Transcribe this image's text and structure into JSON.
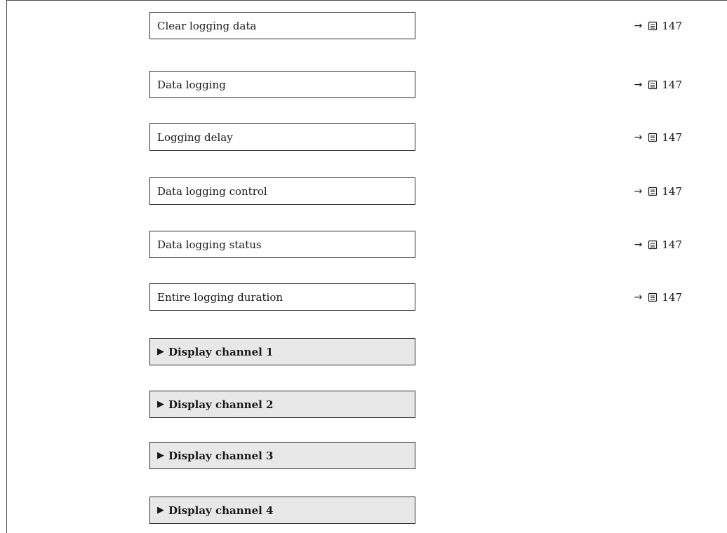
{
  "parameters": [
    {
      "label": "Clear logging data",
      "ref_page": "147"
    },
    {
      "label": "Data logging",
      "ref_page": "147"
    },
    {
      "label": "Logging delay",
      "ref_page": "147"
    },
    {
      "label": "Data logging control",
      "ref_page": "147"
    },
    {
      "label": "Data logging status",
      "ref_page": "147"
    },
    {
      "label": "Entire logging duration",
      "ref_page": "147"
    }
  ],
  "submenus": [
    {
      "label": "Display channel 1"
    },
    {
      "label": "Display channel 2"
    },
    {
      "label": "Display channel 3"
    },
    {
      "label": "Display channel 4"
    }
  ],
  "icons": {
    "arrow": "right-arrow-icon",
    "book": "book-icon",
    "submenu": "triangle-right-icon"
  }
}
